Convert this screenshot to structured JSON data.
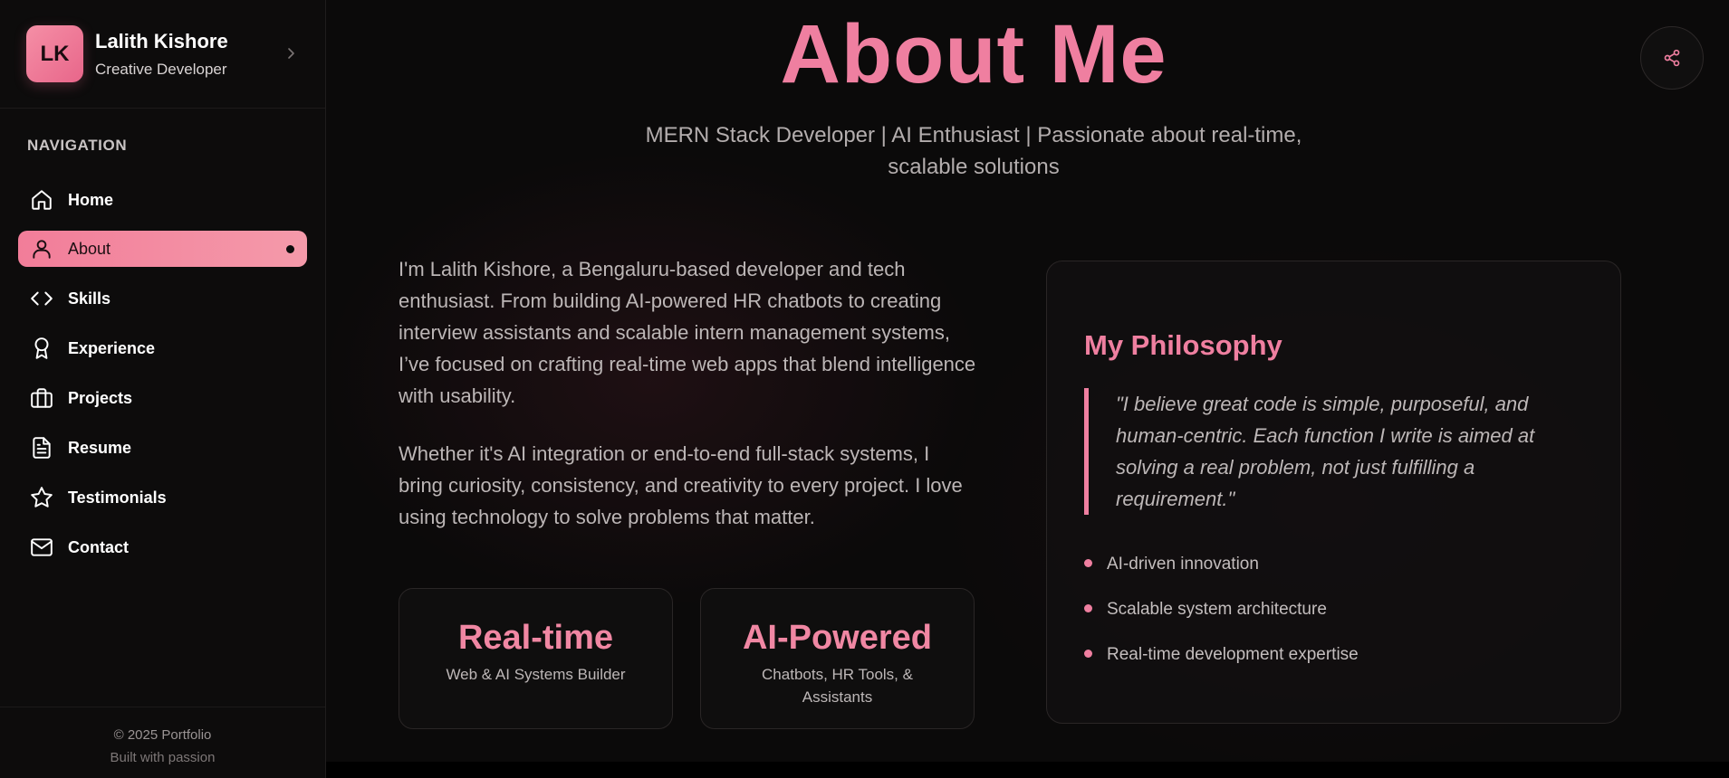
{
  "sidebar": {
    "avatar_initials": "LK",
    "name": "Lalith Kishore",
    "role": "Creative Developer",
    "collapse_icon": "chevron-right-icon",
    "nav_heading": "NAVIGATION",
    "items": [
      {
        "label": "Home",
        "icon": "home-icon",
        "active": false
      },
      {
        "label": "About",
        "icon": "user-icon",
        "active": true
      },
      {
        "label": "Skills",
        "icon": "code-icon",
        "active": false
      },
      {
        "label": "Experience",
        "icon": "award-icon",
        "active": false
      },
      {
        "label": "Projects",
        "icon": "briefcase-icon",
        "active": false
      },
      {
        "label": "Resume",
        "icon": "document-icon",
        "active": false
      },
      {
        "label": "Testimonials",
        "icon": "star-icon",
        "active": false
      },
      {
        "label": "Contact",
        "icon": "mail-icon",
        "active": false
      }
    ],
    "footer": {
      "copyright": "© 2025 Portfolio",
      "tagline": "Built with passion"
    }
  },
  "main": {
    "title": "About Me",
    "subtitle": "MERN Stack Developer | AI Enthusiast | Passionate about real-time, scalable solutions",
    "share_icon": "share-icon",
    "bio": [
      "I'm Lalith Kishore, a Bengaluru-based developer and tech enthusiast. From building AI-powered HR chatbots to creating interview assistants and scalable intern management systems, I’ve focused on crafting real-time web apps that blend intelligence with usability.",
      "Whether it's AI integration or end-to-end full-stack systems, I bring curiosity, consistency, and creativity to every project. I love using technology to solve problems that matter."
    ],
    "stats": [
      {
        "value": "Real-time",
        "caption": "Web & AI Systems Builder"
      },
      {
        "value": "AI-Powered",
        "caption": "Chatbots, HR Tools, & Assistants"
      }
    ],
    "philosophy": {
      "title": "My Philosophy",
      "quote": "\"I believe great code is simple, purposeful, and human-centric. Each function I write is aimed at solving a real problem, not just fulfilling a requirement.\"",
      "points": [
        "AI-driven innovation",
        "Scalable system architecture",
        "Real-time development expertise"
      ]
    }
  },
  "colors": {
    "accent": "#ef7fa0",
    "background": "#0b0a0a",
    "sidebar": "#0d0c0c",
    "text_muted": "#bcb6b6"
  }
}
